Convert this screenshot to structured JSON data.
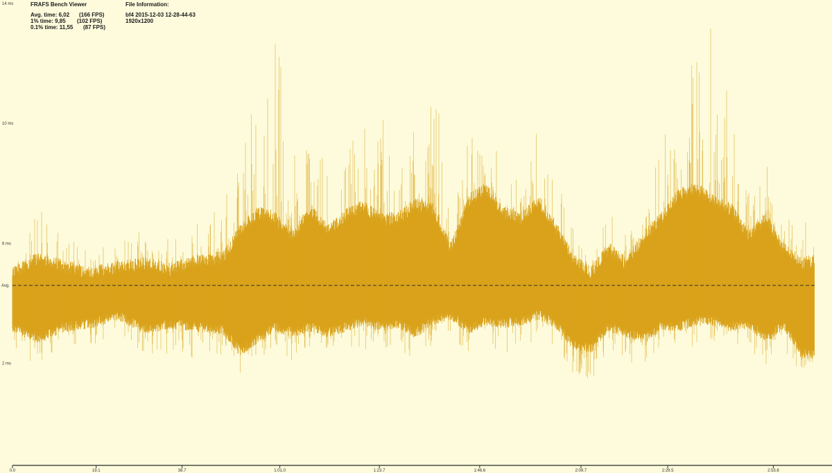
{
  "app": {
    "title": "FRAFS Bench Viewer"
  },
  "stats": [
    {
      "label": "Avg. time: 6,02",
      "fps": "(166 FPS)"
    },
    {
      "label": "1% time: 9,85",
      "fps": "(102 FPS)"
    },
    {
      "label": "0.1% time: 11,55",
      "fps": "(87 FPS)"
    }
  ],
  "file_info": {
    "title": "File Information:",
    "name": "bf4 2015-12-03 12-28-44-63",
    "resolution": "1920x1200"
  },
  "colors": {
    "background": "#fdfbdc",
    "series": "#d9a21a",
    "axis": "#2a2a2a",
    "avg_line": "#3a3020"
  },
  "chart_data": {
    "type": "area",
    "title": "",
    "xlabel": "",
    "ylabel": "",
    "xlim": [
      0,
      183.5
    ],
    "ylim": [
      -1.4,
      14
    ],
    "grid": false,
    "y_ticks": [
      "2 ms",
      "6 ms",
      "10 ms",
      "14 ms"
    ],
    "y_tick_values": [
      2,
      6,
      10,
      14
    ],
    "avg_label": "Avg.",
    "avg_value": 4.6,
    "x_ticks": [
      "0.0",
      "19.1",
      "38.7",
      "1:01.0",
      "1:23.7",
      "1:46.6",
      "2:09.7",
      "2:29.5",
      "2:53.6"
    ],
    "x_tick_values": [
      0,
      19.1,
      38.7,
      61.0,
      83.7,
      106.6,
      129.7,
      149.5,
      173.6
    ],
    "series": [
      {
        "x": [
          0,
          6,
          12,
          18,
          24,
          30,
          36,
          42,
          48,
          52,
          56,
          60,
          64,
          68,
          72,
          76,
          80,
          84,
          88,
          92,
          96,
          100,
          104,
          108,
          112,
          116,
          120,
          124,
          128,
          132,
          136,
          140,
          144,
          148,
          152,
          156,
          160,
          164,
          168,
          172,
          176,
          180,
          183
        ],
        "low": [
          3.4,
          3.0,
          3.4,
          3.5,
          3.8,
          3.3,
          3.5,
          3.4,
          3.3,
          2.6,
          3.0,
          3.4,
          3.2,
          3.4,
          3.2,
          3.4,
          3.6,
          3.4,
          3.5,
          3.2,
          3.6,
          3.8,
          3.3,
          3.6,
          3.5,
          3.6,
          3.8,
          3.5,
          2.8,
          2.7,
          3.4,
          3.2,
          3.0,
          3.4,
          3.4,
          3.6,
          3.6,
          3.4,
          3.5,
          3.0,
          3.5,
          2.5,
          2.5
        ],
        "high": [
          4.8,
          5.3,
          5.0,
          4.8,
          5.0,
          5.1,
          4.9,
          5.2,
          5.3,
          6.2,
          6.8,
          6.6,
          6.0,
          6.9,
          6.2,
          6.7,
          7.0,
          6.6,
          6.6,
          7.1,
          6.9,
          5.6,
          7.2,
          7.6,
          6.8,
          6.6,
          7.2,
          6.3,
          5.2,
          4.8,
          5.6,
          5.1,
          6.0,
          6.6,
          7.4,
          7.6,
          7.2,
          6.9,
          6.0,
          6.6,
          5.6,
          5.1,
          5.2
        ],
        "peak": [
          5.8,
          7.2,
          6.2,
          5.9,
          6.0,
          6.7,
          6.1,
          6.7,
          7.6,
          8.7,
          11.6,
          13.8,
          8.9,
          9.6,
          8.8,
          9.2,
          10.9,
          10.5,
          9.2,
          10.6,
          12.2,
          7.1,
          9.4,
          10.6,
          8.2,
          8.4,
          10.4,
          8.6,
          6.7,
          5.3,
          7.2,
          6.4,
          8.1,
          9.3,
          11.5,
          12.5,
          13.3,
          11.2,
          7.8,
          8.7,
          6.8,
          7.0,
          6.2
        ],
        "trough": [
          2.3,
          1.9,
          2.5,
          2.5,
          3.0,
          2.3,
          2.3,
          1.9,
          2.3,
          1.4,
          2.0,
          2.6,
          2.0,
          2.6,
          2.3,
          2.4,
          2.4,
          2.5,
          2.6,
          1.9,
          2.6,
          2.8,
          2.3,
          2.7,
          2.3,
          2.6,
          2.7,
          2.6,
          1.5,
          1.3,
          2.3,
          2.1,
          1.8,
          2.3,
          2.4,
          2.6,
          2.6,
          2.5,
          2.5,
          1.9,
          2.3,
          1.7,
          1.6
        ]
      }
    ]
  }
}
